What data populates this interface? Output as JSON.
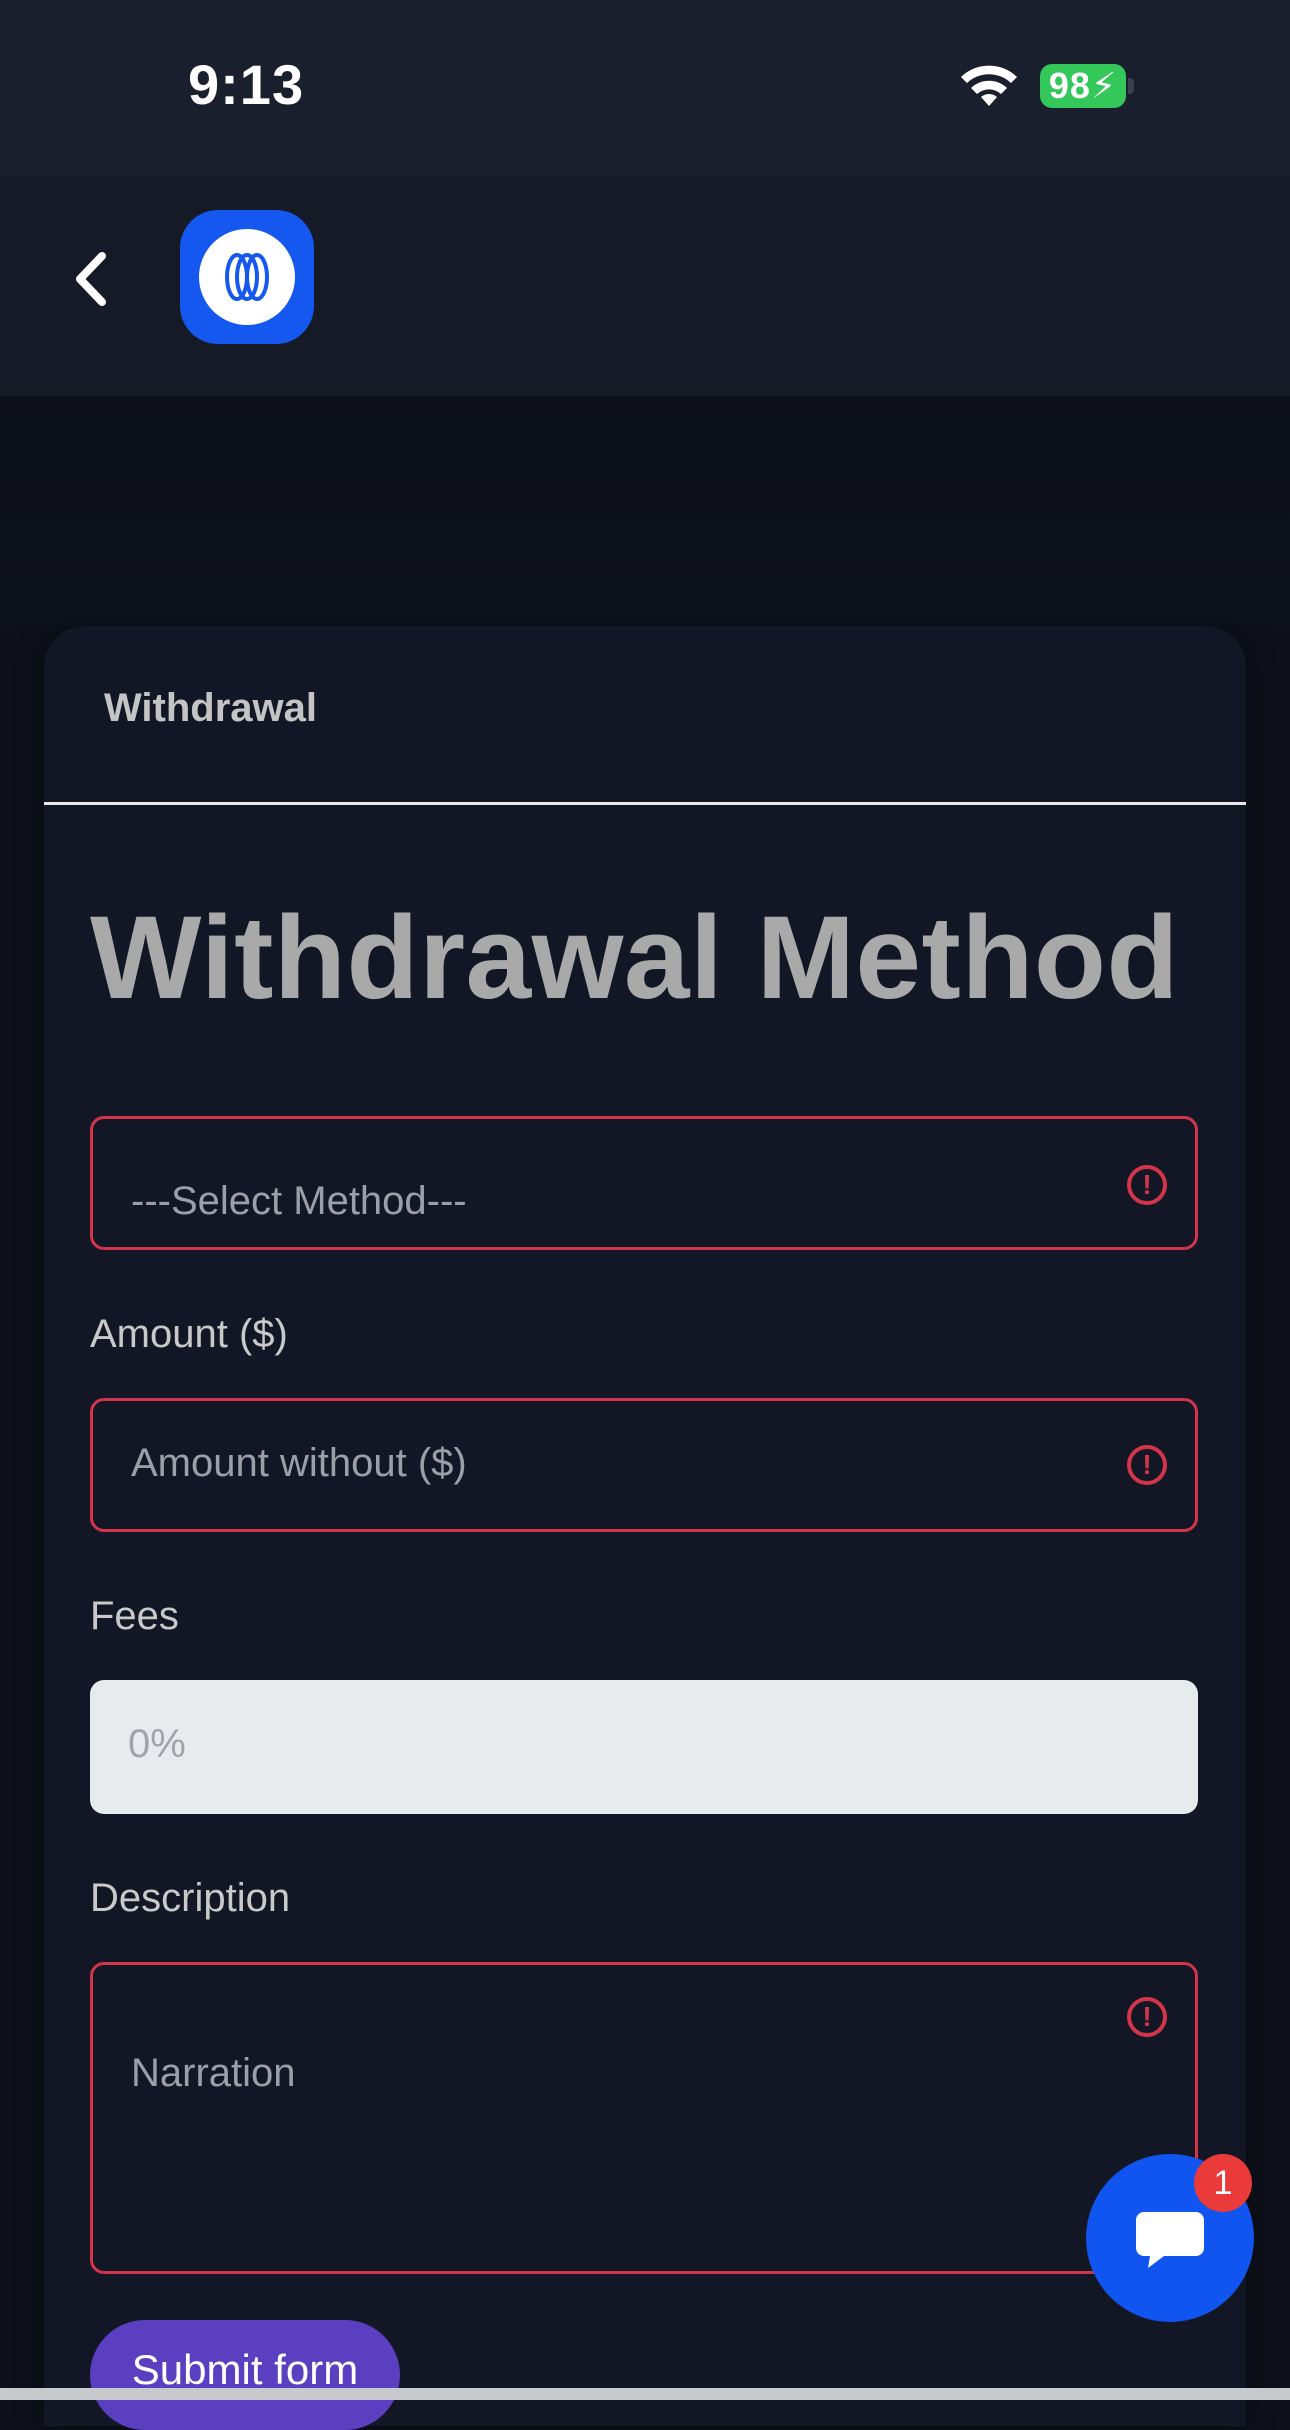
{
  "status_bar": {
    "time": "9:13",
    "battery": "98",
    "icons": [
      "wifi-icon",
      "battery-charging-icon"
    ]
  },
  "header": {
    "back_icon": "chevron-left-icon",
    "logo": "app-logo"
  },
  "card": {
    "tab_label": "Withdrawal",
    "title": "Withdrawal Method"
  },
  "form": {
    "method": {
      "selected": "---Select Method---",
      "error_icon": "alert-circle-icon"
    },
    "amount": {
      "label": "Amount ($)",
      "placeholder": "Amount without ($)"
    },
    "fees": {
      "label": "Fees",
      "value": "0%"
    },
    "description": {
      "label": "Description",
      "placeholder": "Narration"
    },
    "submit_label": "Submit form"
  },
  "chat": {
    "icon": "chat-bubble-icon",
    "badge_count": "1"
  },
  "colors": {
    "error": "#d2344a",
    "accent": "#1458f0",
    "submit": "#5a3fc0",
    "badge": "#ea3a3a"
  }
}
